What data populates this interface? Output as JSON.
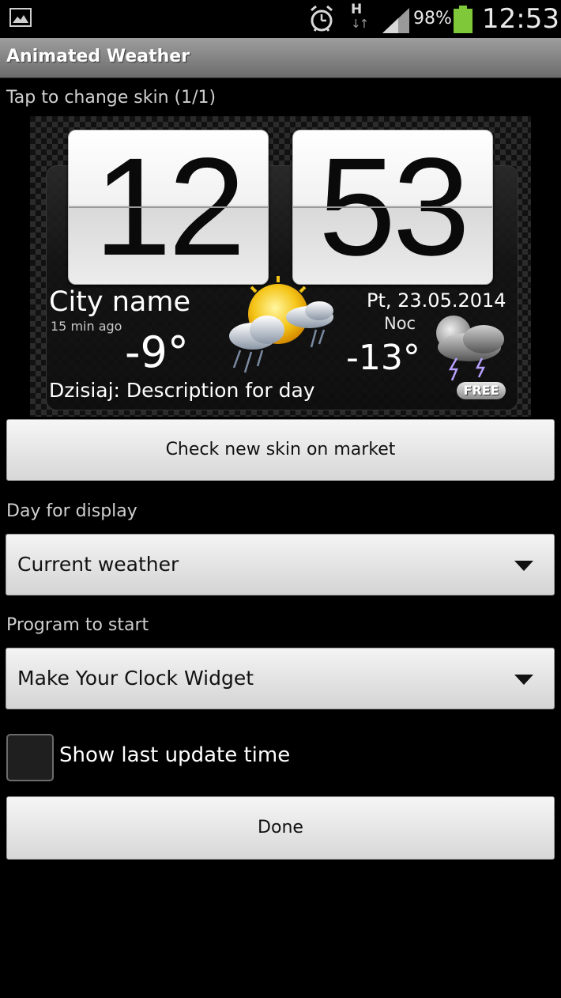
{
  "status_bar": {
    "battery_percent": "98%",
    "battery_level": 0.98,
    "battery_color": "#7ec83a",
    "network_type": "H",
    "time": "12:53",
    "icons": [
      "gallery-icon",
      "alarm-icon",
      "data-arrows-icon",
      "signal-icon",
      "battery-icon"
    ]
  },
  "title_bar": {
    "title": "Animated Weather"
  },
  "skin_section": {
    "label": "Tap to change skin (1/1)",
    "preview": {
      "hours": "12",
      "minutes": "53",
      "city": "City name",
      "updated": "15 min ago",
      "temp_now": "-9°",
      "description": "Dzisiaj: Description for day",
      "date": "Pt, 23.05.2014",
      "day_part": "Noc",
      "temp_night": "-13°",
      "badge": "FREE",
      "icons": [
        "sun-cloud-rain-icon",
        "moon-storm-icon"
      ]
    },
    "market_button": "Check new skin on market"
  },
  "day_display": {
    "label": "Day for display",
    "selected": "Current weather"
  },
  "program_start": {
    "label": "Program to start",
    "selected": "Make Your Clock Widget"
  },
  "last_update": {
    "label": "Show last update time",
    "checked": false
  },
  "done_button": "Done"
}
